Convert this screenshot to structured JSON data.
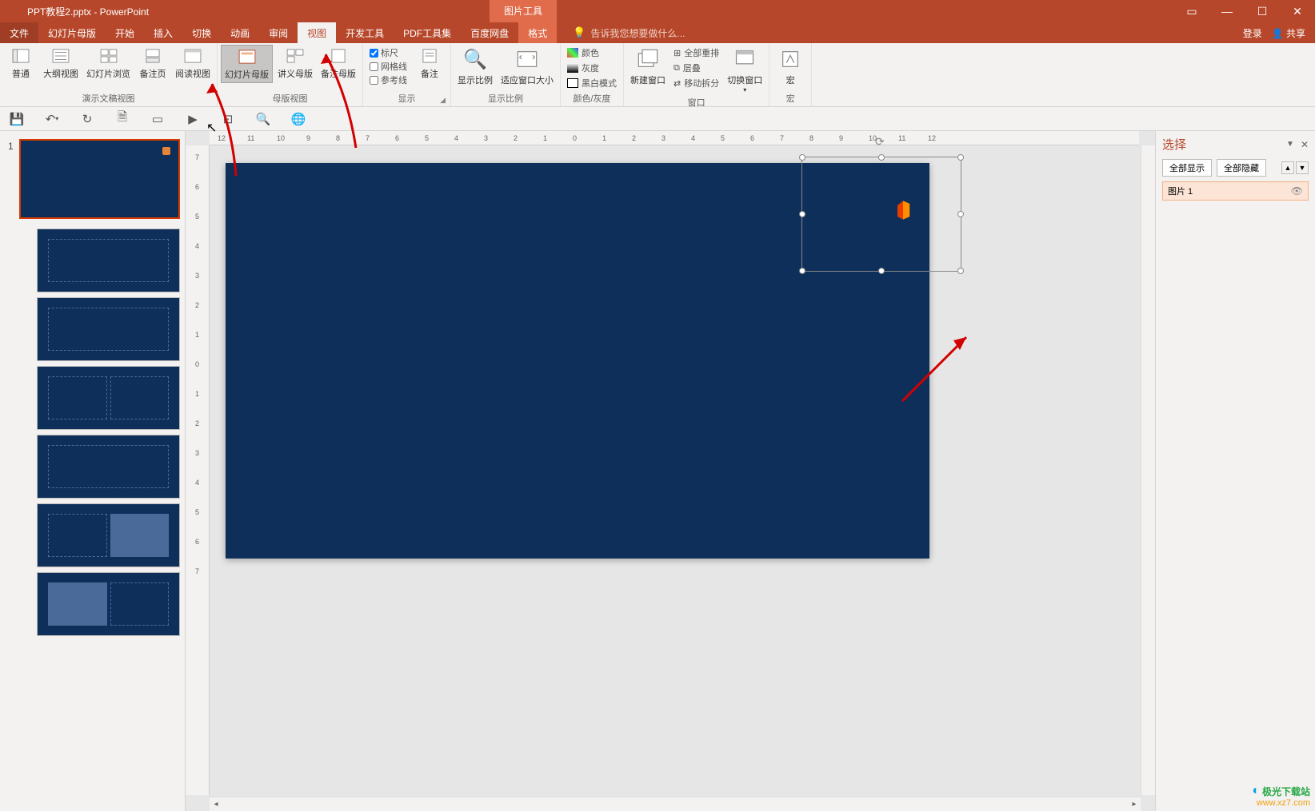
{
  "titlebar": {
    "doc_title": "PPT教程2.pptx - PowerPoint",
    "contextual_title": "图片工具"
  },
  "tabs": {
    "file": "文件",
    "slide_master": "幻灯片母版",
    "home": "开始",
    "insert": "插入",
    "transitions": "切换",
    "animations": "动画",
    "review": "审阅",
    "view": "视图",
    "dev": "开发工具",
    "pdf": "PDF工具集",
    "baidu": "百度网盘",
    "format": "格式"
  },
  "tellme": {
    "placeholder": "告诉我您想要做什么..."
  },
  "right_menu": {
    "login": "登录",
    "share": "共享"
  },
  "ribbon": {
    "group1": {
      "normal": "普通",
      "outline": "大纲视图",
      "sorter": "幻灯片浏览",
      "notes_page": "备注页",
      "reading": "阅读视图",
      "label": "演示文稿视图"
    },
    "group2": {
      "slide_master": "幻灯片母版",
      "handout_master": "讲义母版",
      "notes_master": "备注母版",
      "label": "母版视图"
    },
    "group3": {
      "ruler": "标尺",
      "gridlines": "网格线",
      "guides": "参考线",
      "notes": "备注",
      "label": "显示"
    },
    "group4": {
      "zoom": "显示比例",
      "fit": "适应窗口大小",
      "label": "显示比例"
    },
    "group5": {
      "color": "颜色",
      "gray": "灰度",
      "bw": "黑白模式",
      "label": "颜色/灰度"
    },
    "group6": {
      "new_window": "新建窗口",
      "arrange_all": "全部重排",
      "cascade": "层叠",
      "move_split": "移动拆分",
      "switch": "切换窗口",
      "label": "窗口"
    },
    "group7": {
      "macros": "宏",
      "label": "宏"
    }
  },
  "slide_panel": {
    "master_num": "1"
  },
  "selection_pane": {
    "title": "选择",
    "show_all": "全部显示",
    "hide_all": "全部隐藏",
    "item1": "图片 1"
  },
  "ruler_h": [
    "12",
    "11",
    "10",
    "9",
    "8",
    "7",
    "6",
    "5",
    "4",
    "3",
    "2",
    "1",
    "0",
    "1",
    "2",
    "3",
    "4",
    "5",
    "6",
    "7",
    "8",
    "9",
    "10",
    "11",
    "12"
  ],
  "ruler_v": [
    "7",
    "6",
    "5",
    "4",
    "3",
    "2",
    "1",
    "0",
    "1",
    "2",
    "3",
    "4",
    "5",
    "6",
    "7"
  ],
  "watermark": {
    "line1": "极光下载站",
    "line2": "www.xz7.com"
  }
}
